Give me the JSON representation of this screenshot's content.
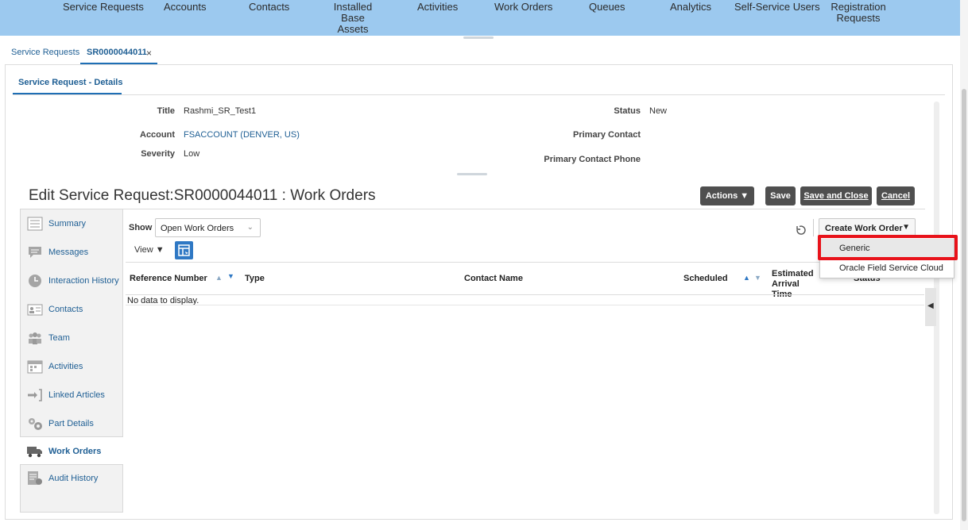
{
  "top_nav": [
    {
      "label": "Service Requests"
    },
    {
      "label": "Accounts"
    },
    {
      "label": "Contacts"
    },
    {
      "label": "Installed Base\nAssets"
    },
    {
      "label": "Activities"
    },
    {
      "label": "Work Orders"
    },
    {
      "label": "Queues"
    },
    {
      "label": "Analytics"
    },
    {
      "label": "Self-Service Users"
    },
    {
      "label": "Registration\nRequests"
    }
  ],
  "breadcrumbs": {
    "parent": "Service Requests",
    "active": "SR0000044011",
    "close_glyph": "×"
  },
  "subtab": "Service Request - Details",
  "details": {
    "title_label": "Title",
    "title_value": "Rashmi_SR_Test1",
    "account_label": "Account",
    "account_value": "FSACCOUNT (DENVER, US)",
    "severity_label": "Severity",
    "severity_value": "Low",
    "status_label": "Status",
    "status_value": "New",
    "primary_contact_label": "Primary Contact",
    "primary_contact_phone_label": "Primary Contact Phone"
  },
  "edit_title": "Edit Service Request:SR0000044011 : Work Orders",
  "buttons": {
    "actions": "Actions ▼",
    "save": "Save",
    "save_close": "Save and Close",
    "cancel": "Cancel"
  },
  "side_nav": [
    {
      "label": "Summary",
      "icon": "summary-icon"
    },
    {
      "label": "Messages",
      "icon": "messages-icon"
    },
    {
      "label": "Interaction History",
      "icon": "clock-icon"
    },
    {
      "label": "Contacts",
      "icon": "contact-card-icon"
    },
    {
      "label": "Team",
      "icon": "team-icon"
    },
    {
      "label": "Activities",
      "icon": "calendar-icon"
    },
    {
      "label": "Linked Articles",
      "icon": "linked-articles-icon"
    },
    {
      "label": "Part Details",
      "icon": "gears-icon"
    },
    {
      "label": "Work Orders",
      "icon": "truck-icon",
      "selected": true
    },
    {
      "label": "Audit History",
      "icon": "audit-icon"
    }
  ],
  "toolbar": {
    "show_label": "Show",
    "show_value": "Open Work Orders",
    "view_label": "View ▼",
    "create_work_order": "Create Work Order"
  },
  "table": {
    "columns": [
      "Reference Number",
      "Type",
      "Contact Name",
      "Scheduled",
      "Estimated Arrival Time",
      "Status"
    ],
    "empty_text": "No data to display."
  },
  "dropdown": {
    "items": [
      "Generic",
      "Oracle Field Service Cloud"
    ]
  },
  "colors": {
    "nav_bg": "#9cc9ef",
    "link": "#1f5f94",
    "highlight": "#e8121a",
    "button_dark": "#4f4f4f"
  }
}
